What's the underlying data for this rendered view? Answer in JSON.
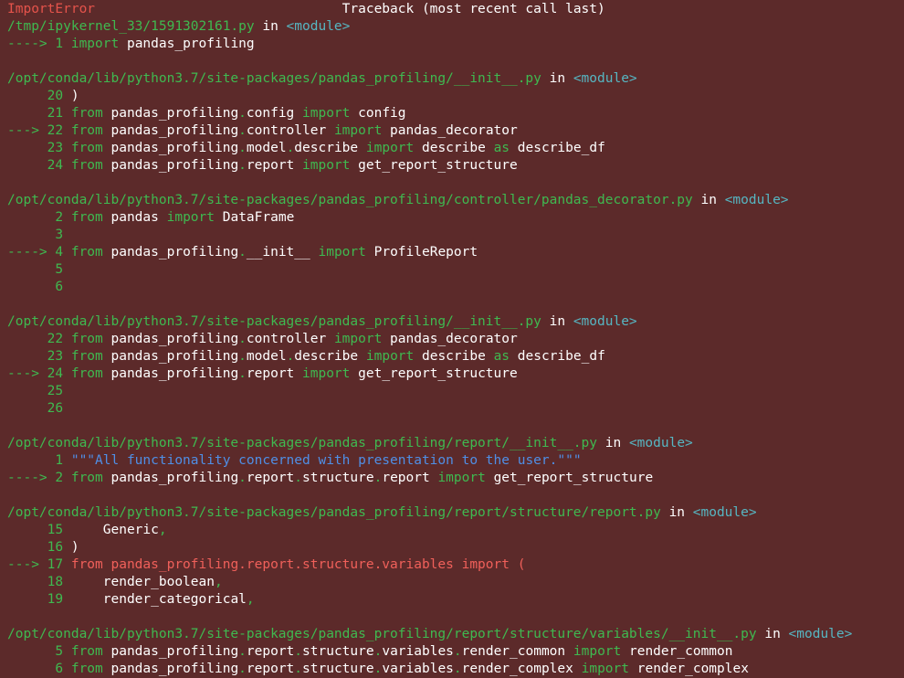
{
  "colors": {
    "background": "#5c2a2a",
    "error_red": "#e5534b",
    "highlight_red": "#f0605a",
    "text": "#ffffff",
    "path_green": "#3fb950",
    "module_cyan": "#56b6c2",
    "string_blue": "#4f8fe6"
  },
  "lines": [
    [
      [
        "ImportError",
        "red"
      ],
      [
        "                               Traceback (most recent call last)",
        "white"
      ]
    ],
    [
      [
        "/tmp/ipykernel_33/1591302161.py",
        "green"
      ],
      [
        " in ",
        "white"
      ],
      [
        "<module>",
        "cyan"
      ]
    ],
    [
      [
        "----> 1 ",
        "green"
      ],
      [
        "import",
        "green"
      ],
      [
        " pandas_profiling",
        "white"
      ]
    ],
    [],
    [
      [
        "/opt/conda/lib/python3.7/site-packages/pandas_profiling/__init__.py",
        "green"
      ],
      [
        " in ",
        "white"
      ],
      [
        "<module>",
        "cyan"
      ]
    ],
    [
      [
        "     20 ",
        "green"
      ],
      [
        ")",
        "white"
      ]
    ],
    [
      [
        "     21 ",
        "green"
      ],
      [
        "from",
        "green"
      ],
      [
        " pandas_profiling",
        "white"
      ],
      [
        ".",
        "green"
      ],
      [
        "config ",
        "white"
      ],
      [
        "import",
        "green"
      ],
      [
        " config",
        "white"
      ]
    ],
    [
      [
        "---> 22 ",
        "green"
      ],
      [
        "from",
        "green"
      ],
      [
        " pandas_profiling",
        "white"
      ],
      [
        ".",
        "green"
      ],
      [
        "controller ",
        "white"
      ],
      [
        "import",
        "green"
      ],
      [
        " pandas_decorator",
        "white"
      ]
    ],
    [
      [
        "     23 ",
        "green"
      ],
      [
        "from",
        "green"
      ],
      [
        " pandas_profiling",
        "white"
      ],
      [
        ".",
        "green"
      ],
      [
        "model",
        "white"
      ],
      [
        ".",
        "green"
      ],
      [
        "describe ",
        "white"
      ],
      [
        "import",
        "green"
      ],
      [
        " describe ",
        "white"
      ],
      [
        "as",
        "green"
      ],
      [
        " describe_df",
        "white"
      ]
    ],
    [
      [
        "     24 ",
        "green"
      ],
      [
        "from",
        "green"
      ],
      [
        " pandas_profiling",
        "white"
      ],
      [
        ".",
        "green"
      ],
      [
        "report ",
        "white"
      ],
      [
        "import",
        "green"
      ],
      [
        " get_report_structure",
        "white"
      ]
    ],
    [],
    [
      [
        "/opt/conda/lib/python3.7/site-packages/pandas_profiling/controller/pandas_decorator.py",
        "green"
      ],
      [
        " in ",
        "white"
      ],
      [
        "<module>",
        "cyan"
      ]
    ],
    [
      [
        "      2 ",
        "green"
      ],
      [
        "from",
        "green"
      ],
      [
        " pandas ",
        "white"
      ],
      [
        "import",
        "green"
      ],
      [
        " DataFrame",
        "white"
      ]
    ],
    [
      [
        "      3",
        "green"
      ]
    ],
    [
      [
        "----> 4 ",
        "green"
      ],
      [
        "from",
        "green"
      ],
      [
        " pandas_profiling",
        "white"
      ],
      [
        ".",
        "green"
      ],
      [
        "__init__ ",
        "white"
      ],
      [
        "import",
        "green"
      ],
      [
        " ProfileReport",
        "white"
      ]
    ],
    [
      [
        "      5",
        "green"
      ]
    ],
    [
      [
        "      6",
        "green"
      ]
    ],
    [],
    [
      [
        "/opt/conda/lib/python3.7/site-packages/pandas_profiling/__init__.py",
        "green"
      ],
      [
        " in ",
        "white"
      ],
      [
        "<module>",
        "cyan"
      ]
    ],
    [
      [
        "     22 ",
        "green"
      ],
      [
        "from",
        "green"
      ],
      [
        " pandas_profiling",
        "white"
      ],
      [
        ".",
        "green"
      ],
      [
        "controller ",
        "white"
      ],
      [
        "import",
        "green"
      ],
      [
        " pandas_decorator",
        "white"
      ]
    ],
    [
      [
        "     23 ",
        "green"
      ],
      [
        "from",
        "green"
      ],
      [
        " pandas_profiling",
        "white"
      ],
      [
        ".",
        "green"
      ],
      [
        "model",
        "white"
      ],
      [
        ".",
        "green"
      ],
      [
        "describe ",
        "white"
      ],
      [
        "import",
        "green"
      ],
      [
        " describe ",
        "white"
      ],
      [
        "as",
        "green"
      ],
      [
        " describe_df",
        "white"
      ]
    ],
    [
      [
        "---> 24 ",
        "green"
      ],
      [
        "from",
        "green"
      ],
      [
        " pandas_profiling",
        "white"
      ],
      [
        ".",
        "green"
      ],
      [
        "report ",
        "white"
      ],
      [
        "import",
        "green"
      ],
      [
        " get_report_structure",
        "white"
      ]
    ],
    [
      [
        "     25",
        "green"
      ]
    ],
    [
      [
        "     26",
        "green"
      ]
    ],
    [],
    [
      [
        "/opt/conda/lib/python3.7/site-packages/pandas_profiling/report/__init__.py",
        "green"
      ],
      [
        " in ",
        "white"
      ],
      [
        "<module>",
        "cyan"
      ]
    ],
    [
      [
        "      1 ",
        "green"
      ],
      [
        "\"\"\"All functionality concerned with presentation to the user.\"\"\"",
        "blue"
      ]
    ],
    [
      [
        "----> 2 ",
        "green"
      ],
      [
        "from",
        "green"
      ],
      [
        " pandas_profiling",
        "white"
      ],
      [
        ".",
        "green"
      ],
      [
        "report",
        "white"
      ],
      [
        ".",
        "green"
      ],
      [
        "structure",
        "white"
      ],
      [
        ".",
        "green"
      ],
      [
        "report ",
        "white"
      ],
      [
        "import",
        "green"
      ],
      [
        " get_report_structure",
        "white"
      ]
    ],
    [],
    [
      [
        "/opt/conda/lib/python3.7/site-packages/pandas_profiling/report/structure/report.py",
        "green"
      ],
      [
        " in ",
        "white"
      ],
      [
        "<module>",
        "cyan"
      ]
    ],
    [
      [
        "     15 ",
        "green"
      ],
      [
        "    Generic",
        "white"
      ],
      [
        ",",
        "green"
      ]
    ],
    [
      [
        "     16 ",
        "green"
      ],
      [
        ")",
        "white"
      ]
    ],
    [
      [
        "---> 17 ",
        "green"
      ],
      [
        "from pandas_profiling.report.structure.variables import (",
        "ered"
      ]
    ],
    [
      [
        "     18 ",
        "green"
      ],
      [
        "    render_boolean",
        "white"
      ],
      [
        ",",
        "green"
      ]
    ],
    [
      [
        "     19 ",
        "green"
      ],
      [
        "    render_categorical",
        "white"
      ],
      [
        ",",
        "green"
      ]
    ],
    [],
    [
      [
        "/opt/conda/lib/python3.7/site-packages/pandas_profiling/report/structure/variables/__init__.py",
        "green"
      ],
      [
        " in ",
        "white"
      ],
      [
        "<module>",
        "cyan"
      ]
    ],
    [
      [
        "      5 ",
        "green"
      ],
      [
        "from",
        "green"
      ],
      [
        " pandas_profiling",
        "white"
      ],
      [
        ".",
        "green"
      ],
      [
        "report",
        "white"
      ],
      [
        ".",
        "green"
      ],
      [
        "structure",
        "white"
      ],
      [
        ".",
        "green"
      ],
      [
        "variables",
        "white"
      ],
      [
        ".",
        "green"
      ],
      [
        "render_common ",
        "white"
      ],
      [
        "import",
        "green"
      ],
      [
        " render_common",
        "white"
      ]
    ],
    [
      [
        "      6 ",
        "green"
      ],
      [
        "from",
        "green"
      ],
      [
        " pandas_profiling",
        "white"
      ],
      [
        ".",
        "green"
      ],
      [
        "report",
        "white"
      ],
      [
        ".",
        "green"
      ],
      [
        "structure",
        "white"
      ],
      [
        ".",
        "green"
      ],
      [
        "variables",
        "white"
      ],
      [
        ".",
        "green"
      ],
      [
        "render_complex ",
        "white"
      ],
      [
        "import",
        "green"
      ],
      [
        " render_complex",
        "white"
      ]
    ]
  ]
}
